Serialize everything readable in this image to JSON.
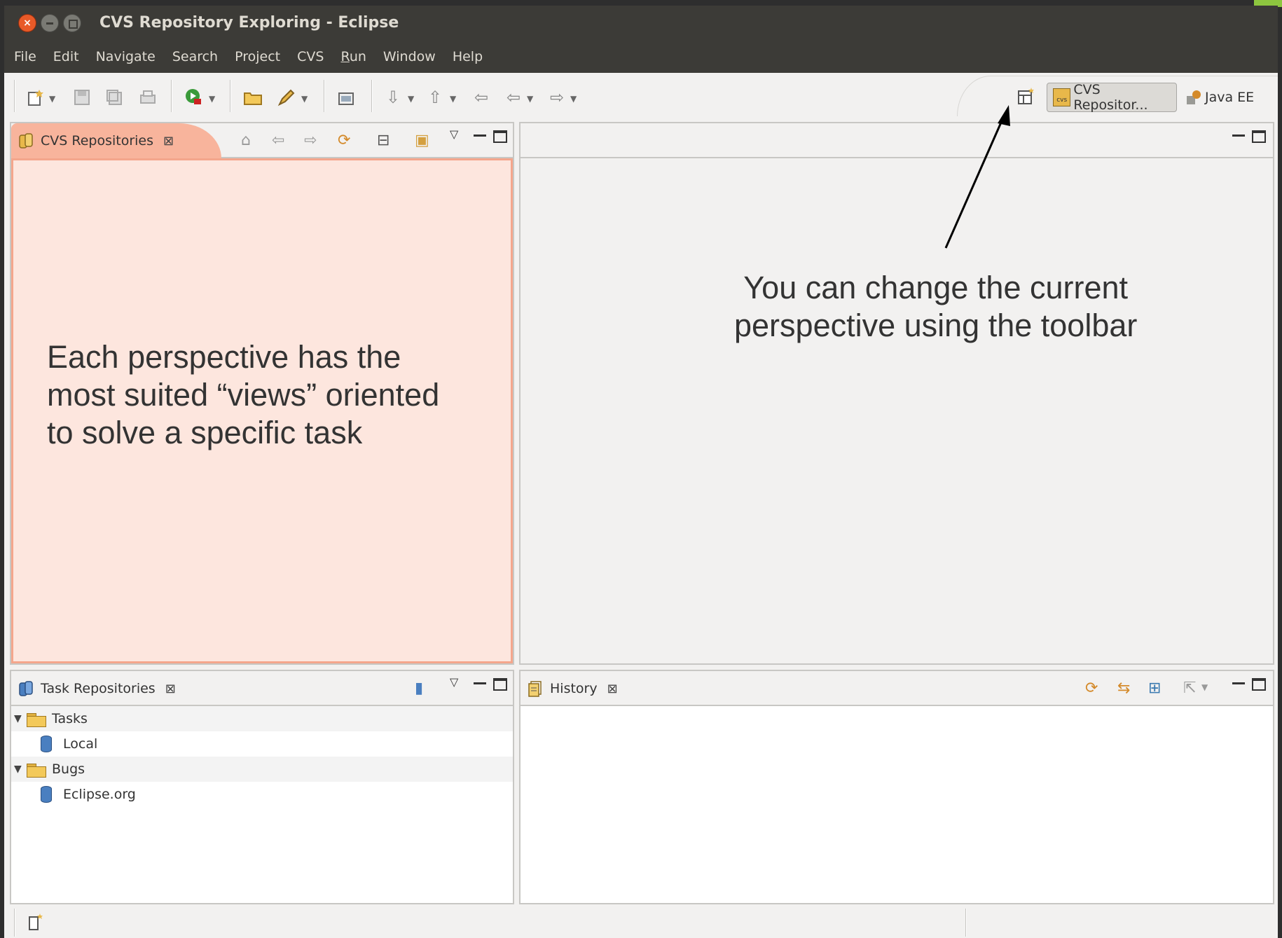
{
  "window": {
    "title": "CVS Repository Exploring - Eclipse",
    "close_glyph": "×"
  },
  "menu": [
    "File",
    "Edit",
    "Navigate",
    "Search",
    "Project",
    "CVS",
    "Run",
    "Window",
    "Help"
  ],
  "perspectives": {
    "active_label": "CVS Repositor...",
    "other_label": "Java EE",
    "active_icon_text": "cvs"
  },
  "views": {
    "cvs_repositories": {
      "label": "CVS Repositories",
      "close": "⊠"
    },
    "task_repositories": {
      "label": "Task Repositories",
      "close": "⊠"
    },
    "history": {
      "label": "History",
      "close": "⊠"
    }
  },
  "task_tree": [
    {
      "label": "Tasks",
      "type": "folder",
      "expanded": true
    },
    {
      "label": "Local",
      "type": "repository"
    },
    {
      "label": "Bugs",
      "type": "folder",
      "expanded": true
    },
    {
      "label": "Eclipse.org",
      "type": "repository"
    }
  ],
  "annotations": {
    "left_line1": "Each perspective has the",
    "left_line2": "most suited “views” oriented",
    "left_line3": "to solve a specific task",
    "right_line1": "You can change the current",
    "right_line2": "perspective using the toolbar"
  },
  "colors": {
    "highlight_fill": "#fde6de",
    "highlight_border": "#f4a68c",
    "titlebar": "#3c3b37",
    "accent_green": "#8dc63f"
  }
}
